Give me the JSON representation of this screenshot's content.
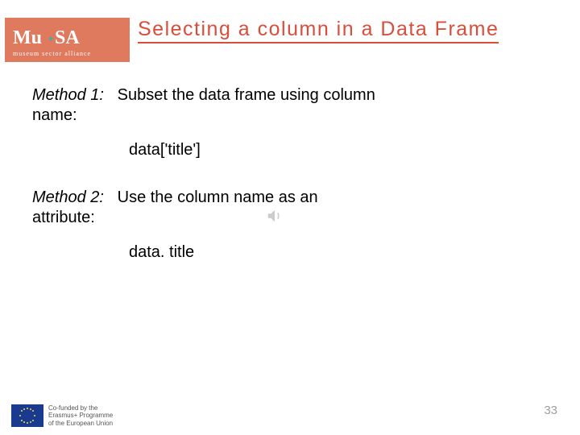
{
  "logo": {
    "main": "Mu.SA",
    "sub": "museum sector alliance"
  },
  "title": "Selecting a column in a Data Frame",
  "method1": {
    "label": "Method 1:",
    "desc_inline": "Subset the data frame using column",
    "desc_below": "name:",
    "code": "data['title']"
  },
  "method2": {
    "label": "Method 2:",
    "desc_inline": "Use the column name as an",
    "desc_below": "attribute:",
    "code": "data. title"
  },
  "footer": {
    "line1": "Co-funded by the",
    "line2": "Erasmus+ Programme",
    "line3": "of the European Union"
  },
  "page_number": "33"
}
